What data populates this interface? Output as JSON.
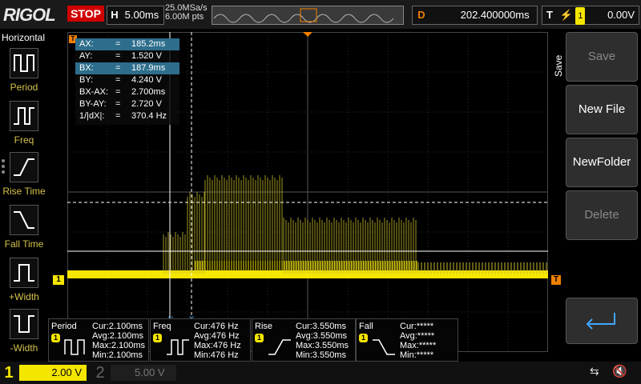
{
  "header": {
    "logo": "RIGOL",
    "run_state": "STOP",
    "timebase_key": "H",
    "timebase": "5.00ms",
    "sample_rate": "25.0MSa/s",
    "mem_depth": "6.00M pts",
    "delay_key": "D",
    "delay": "202.400000ms",
    "trigger_key": "T",
    "trigger_channel": "1",
    "trigger_level": "0.00V"
  },
  "left_menu": {
    "title": "Horizontal",
    "items": [
      {
        "label": "Period"
      },
      {
        "label": "Freq"
      },
      {
        "label": "Rise Time"
      },
      {
        "label": "Fall Time"
      },
      {
        "label": "+Width"
      },
      {
        "label": "-Width"
      }
    ]
  },
  "right_menu": {
    "title": "Save",
    "buttons": [
      {
        "label": "Save",
        "enabled": false
      },
      {
        "label": "New File",
        "enabled": true
      },
      {
        "label": "NewFolder",
        "enabled": true
      },
      {
        "label": "Delete",
        "enabled": false
      }
    ]
  },
  "cursor_readout": [
    {
      "name": "AX:",
      "eq": "=",
      "value": "185.2ms"
    },
    {
      "name": "AY:",
      "eq": "=",
      "value": "1.520 V"
    },
    {
      "name": "BX:",
      "eq": "=",
      "value": "187.9ms"
    },
    {
      "name": "BY:",
      "eq": "=",
      "value": "4.240 V"
    },
    {
      "name": "BX-AX:",
      "eq": "=",
      "value": "2.700ms"
    },
    {
      "name": "BY-AY:",
      "eq": "=",
      "value": "2.720 V"
    },
    {
      "name": "1/|dX|:",
      "eq": "=",
      "value": "370.4 Hz"
    }
  ],
  "markers": {
    "ch1_marker": "1",
    "trigger_marker": "T"
  },
  "measurements": [
    {
      "title": "Period",
      "channel": "1",
      "cur": "Cur:2.100ms",
      "avg": "Avg:2.100ms",
      "max": "Max:2.100ms",
      "min": "Min:2.100ms"
    },
    {
      "title": "Freq",
      "channel": "1",
      "cur": "Cur:476 Hz",
      "avg": "Avg:476 Hz",
      "max": "Max:476 Hz",
      "min": "Min:476 Hz"
    },
    {
      "title": "Rise",
      "channel": "1",
      "cur": "Cur:3.550ms",
      "avg": "Avg:3.550ms",
      "max": "Max:3.550ms",
      "min": "Min:3.550ms"
    },
    {
      "title": "Fall",
      "channel": "1",
      "cur": "Cur:*****",
      "avg": "Avg:*****",
      "max": "Max:*****",
      "min": "Min:*****"
    }
  ],
  "footer": {
    "ch1_label": "1",
    "ch1_scale": "2.00 V",
    "ch2_label": "2",
    "ch2_scale": "5.00 V"
  },
  "colors": {
    "ch1": "#f5e600",
    "delay": "#f08000",
    "highlight": "#2d6e8c",
    "stop": "#d00000"
  }
}
